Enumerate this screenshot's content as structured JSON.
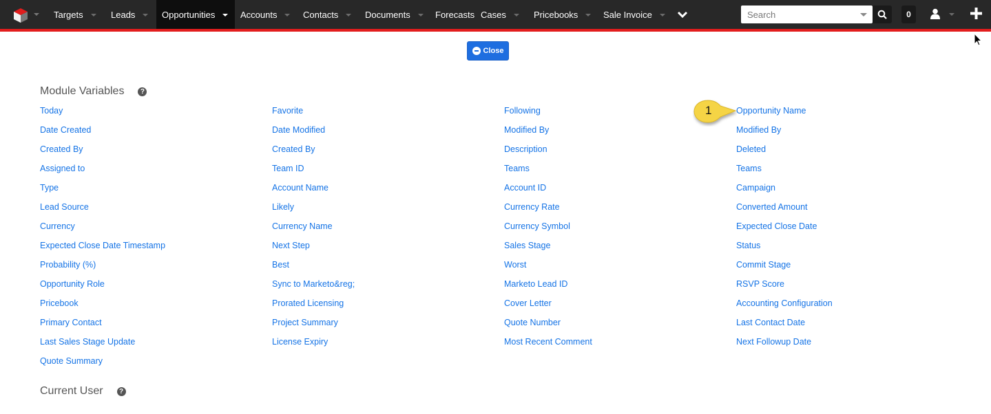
{
  "navbar": {
    "logo": "sugar-cube-logo",
    "items": [
      {
        "label": "Targets",
        "has_caret": true,
        "active": false
      },
      {
        "label": "Leads",
        "has_caret": true,
        "active": false
      },
      {
        "label": "Opportunities",
        "has_caret": true,
        "active": true
      },
      {
        "label": "Accounts",
        "has_caret": true,
        "active": false
      },
      {
        "label": "Contacts",
        "has_caret": true,
        "active": false
      },
      {
        "label": "Documents",
        "has_caret": true,
        "active": false
      },
      {
        "label": "Forecasts",
        "has_caret": false,
        "active": false
      },
      {
        "label": "Cases",
        "has_caret": true,
        "active": false
      },
      {
        "label": "Pricebooks",
        "has_caret": true,
        "active": false
      },
      {
        "label": "Sale Invoice",
        "has_caret": true,
        "active": false
      }
    ],
    "more_icon": "chevron-down-icon",
    "search": {
      "placeholder": "Search",
      "value": ""
    },
    "notification_count": "0",
    "accent_color": "#e21d1d"
  },
  "close_button": {
    "label": "Close",
    "color": "#1e6ee0"
  },
  "sections": {
    "module_variables": {
      "title": "Module Variables",
      "columns": [
        [
          "Today",
          "Date Created",
          "Created By",
          "Assigned to",
          "Type",
          "Lead Source",
          "Currency",
          "Expected Close Date Timestamp",
          "Probability (%)",
          "Opportunity Role",
          "Pricebook",
          "Primary Contact",
          "Last Sales Stage Update",
          "Quote Summary"
        ],
        [
          "Favorite",
          "Date Modified",
          "Created By",
          "Team ID",
          "Account Name",
          "Likely",
          "Currency Name",
          "Next Step",
          "Best",
          "Sync to Marketo&reg;",
          "Prorated Licensing",
          "Project Summary",
          "License Expiry"
        ],
        [
          "Following",
          "Modified By",
          "Description",
          "Teams",
          "Account ID",
          "Currency Rate",
          "Currency Symbol",
          "Sales Stage",
          "Worst",
          "Marketo Lead ID",
          "Cover Letter",
          "Quote Number",
          "Most Recent Comment"
        ],
        [
          "Opportunity Name",
          "Modified By",
          "Deleted",
          "Teams",
          "Campaign",
          "Converted Amount",
          "Expected Close Date",
          "Status",
          "Commit Stage",
          "RSVP Score",
          "Accounting Configuration",
          "Last Contact Date",
          "Next Followup Date"
        ]
      ]
    },
    "current_user": {
      "title": "Current User"
    }
  },
  "callout": {
    "number": "1",
    "color": "#f5d445"
  },
  "link_color": "#1473e6"
}
